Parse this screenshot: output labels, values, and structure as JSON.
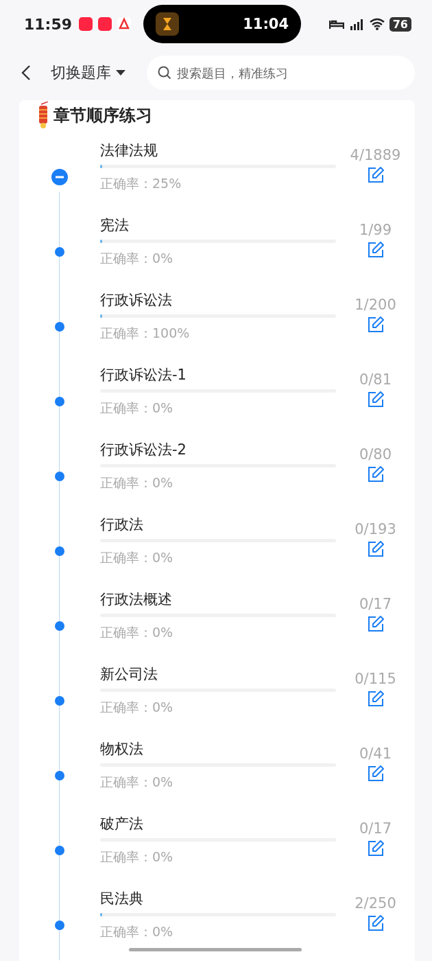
{
  "status_bar": {
    "time": "11:59",
    "island_time": "11:04",
    "battery": "76"
  },
  "header": {
    "bank_switch": "切换题库",
    "search": {
      "placeholder": "搜索题目，精准练习"
    }
  },
  "section": {
    "title": "章节顺序练习"
  },
  "chapters": [
    {
      "kind": "group",
      "expanded": true,
      "name": "法律法规",
      "level": 0.002,
      "accuracy": "正确率：25%",
      "count": "4/1889"
    },
    {
      "kind": "chapter",
      "name": "宪法",
      "level": 0.01,
      "accuracy": "正确率：0%",
      "count": "1/99"
    },
    {
      "kind": "chapter",
      "name": "行政诉讼法",
      "level": 0.005,
      "accuracy": "正确率：100%",
      "count": "1/200"
    },
    {
      "kind": "chapter",
      "name": "行政诉讼法-1",
      "level": 0,
      "accuracy": "正确率：0%",
      "count": "0/81"
    },
    {
      "kind": "chapter",
      "name": "行政诉讼法-2",
      "level": 0,
      "accuracy": "正确率：0%",
      "count": "0/80"
    },
    {
      "kind": "chapter",
      "name": "行政法",
      "level": 0,
      "accuracy": "正确率：0%",
      "count": "0/193"
    },
    {
      "kind": "chapter",
      "name": "行政法概述",
      "level": 0,
      "accuracy": "正确率：0%",
      "count": "0/17"
    },
    {
      "kind": "chapter",
      "name": "新公司法",
      "level": 0,
      "accuracy": "正确率：0%",
      "count": "0/115"
    },
    {
      "kind": "chapter",
      "name": "物权法",
      "level": 0,
      "accuracy": "正确率：0%",
      "count": "0/41"
    },
    {
      "kind": "chapter",
      "name": "破产法",
      "level": 0,
      "accuracy": "正确率：0%",
      "count": "0/17"
    },
    {
      "kind": "chapter",
      "name": "民法典",
      "level": 0.008,
      "accuracy": "正确率：0%",
      "count": "2/250"
    }
  ]
}
